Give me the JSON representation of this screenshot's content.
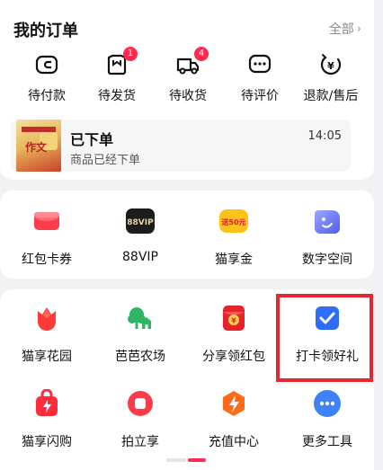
{
  "orders": {
    "title": "我的订单",
    "all_label": "全部",
    "tabs": [
      {
        "label": "待付款",
        "icon": "wallet-icon",
        "badge": ""
      },
      {
        "label": "待发货",
        "icon": "package-icon",
        "badge": "1"
      },
      {
        "label": "待收货",
        "icon": "delivery-truck-icon",
        "badge": "4"
      },
      {
        "label": "待评价",
        "icon": "comment-icon",
        "badge": ""
      },
      {
        "label": "退款/售后",
        "icon": "refund-icon",
        "badge": ""
      }
    ],
    "latest": {
      "status": "已下单",
      "description": "商品已经下单",
      "time": "14:05",
      "thumb_icon": "book-cover-thumbnail",
      "thumb_text": "作文"
    }
  },
  "services": [
    {
      "label": "红包卡券",
      "icon": "red-envelope-icon"
    },
    {
      "label": "88VIP",
      "icon": "88vip-icon",
      "icon_text": "88VIP"
    },
    {
      "label": "猫享金",
      "icon": "cat-gold-coupon-icon",
      "icon_text": "送50元"
    },
    {
      "label": "数字空间",
      "icon": "digital-space-icon"
    }
  ],
  "tools": [
    {
      "label": "猫享花园",
      "icon": "tulip-icon"
    },
    {
      "label": "芭芭农场",
      "icon": "farm-tree-icon"
    },
    {
      "label": "分享领红包",
      "icon": "share-red-packet-icon"
    },
    {
      "label": "打卡领好礼",
      "icon": "checkin-checkbox-icon"
    },
    {
      "label": "猫享闪购",
      "icon": "flash-buy-bag-icon"
    },
    {
      "label": "拍立享",
      "icon": "snap-share-icon"
    },
    {
      "label": "充值中心",
      "icon": "recharge-lightning-icon"
    },
    {
      "label": "更多工具",
      "icon": "more-dots-icon"
    }
  ],
  "colors": {
    "accent_red": "#ff2a4d",
    "highlight_border": "#e8262f",
    "farm_green": "#2fb565",
    "checkin_blue": "#2f6df6",
    "recharge_orange": "#ff6a1a",
    "more_blue": "#3f82f7"
  },
  "pager": {
    "active_index": 1,
    "count": 2
  }
}
